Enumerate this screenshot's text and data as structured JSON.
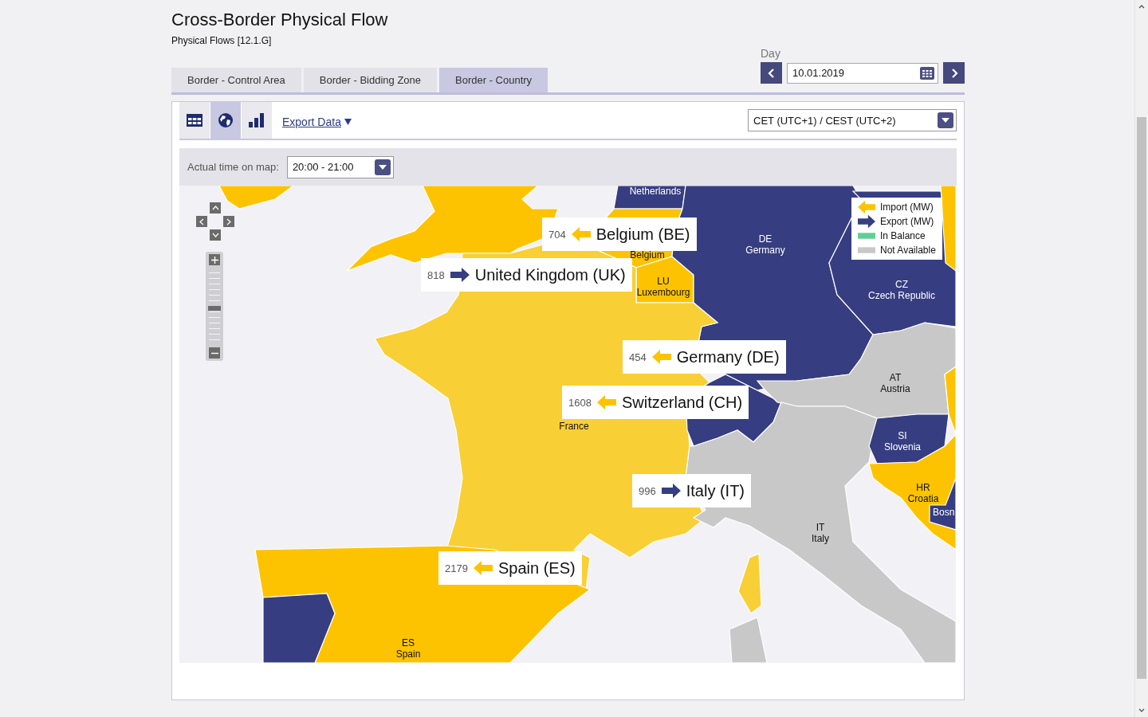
{
  "page": {
    "title": "Cross-Border Physical Flow",
    "subtitle": "Physical Flows [12.1.G]"
  },
  "tabs": [
    {
      "label": "Border - Control Area",
      "selected": false
    },
    {
      "label": "Border - Bidding Zone",
      "selected": false
    },
    {
      "label": "Border - Country",
      "selected": true
    }
  ],
  "day": {
    "label": "Day",
    "value": "10.01.2019"
  },
  "views": [
    {
      "kind": "table",
      "selected": false
    },
    {
      "kind": "map",
      "selected": true
    },
    {
      "kind": "chart",
      "selected": false
    }
  ],
  "export": {
    "label": "Export Data"
  },
  "timezone": {
    "value": "CET (UTC+1) / CEST (UTC+2)"
  },
  "time_on_map": {
    "label": "Actual time on map:",
    "value": "20:00 - 21:00"
  },
  "map": {
    "zoom": {
      "level": 0.47
    },
    "countries": [
      {
        "kind": "import",
        "selected": false
      },
      {
        "kind": "import",
        "selected": false
      },
      {
        "name": "Netherlands",
        "kind": "export",
        "selected": false
      },
      {
        "name": "Belgium",
        "kind": "import",
        "selected": false
      },
      {
        "code": "LU",
        "name": "Luxembourg",
        "kind": "import",
        "selected": false
      },
      {
        "code": "DE",
        "name": "Germany",
        "kind": "export",
        "selected": false
      },
      {
        "code": "CZ",
        "name": "Czech Republic",
        "kind": "export",
        "selected": false
      },
      {
        "name": "France",
        "kind": "import",
        "selected": true
      },
      {
        "code": "ES",
        "name": "Spain",
        "kind": "import",
        "selected": false
      },
      {
        "kind": "export",
        "selected": false
      },
      {
        "kind": "export",
        "selected": false
      },
      {
        "code": "AT",
        "name": "Austria",
        "kind": "not_available",
        "selected": false
      },
      {
        "code": "IT",
        "name": "Italy",
        "kind": "not_available",
        "selected": false
      },
      {
        "code": "SI",
        "name": "Slovenia",
        "kind": "export",
        "selected": false
      },
      {
        "code": "HR",
        "name": "Croatia",
        "kind": "import",
        "selected": false
      },
      {
        "name": "Bosn",
        "kind": "export",
        "selected": false
      },
      {
        "kind": "import",
        "selected": false
      },
      {
        "kind": "import",
        "selected": false
      }
    ],
    "flows": [
      {
        "value": "704",
        "kind": "import",
        "country": "Belgium (BE)"
      },
      {
        "value": "818",
        "kind": "export",
        "country": "United Kingdom (UK)"
      },
      {
        "value": "454",
        "kind": "import",
        "country": "Germany (DE)"
      },
      {
        "value": "1608",
        "kind": "import",
        "country": "Switzerland (CH)"
      },
      {
        "value": "996",
        "kind": "export",
        "country": "Italy (IT)"
      },
      {
        "value": "2179",
        "kind": "import",
        "country": "Spain (ES)"
      }
    ],
    "legend": [
      {
        "kind": "import",
        "label": "Import (MW)"
      },
      {
        "kind": "export",
        "label": "Export (MW)"
      },
      {
        "kind": "balance",
        "label": "In Balance"
      },
      {
        "kind": "not_available",
        "label": "Not Available"
      }
    ]
  }
}
